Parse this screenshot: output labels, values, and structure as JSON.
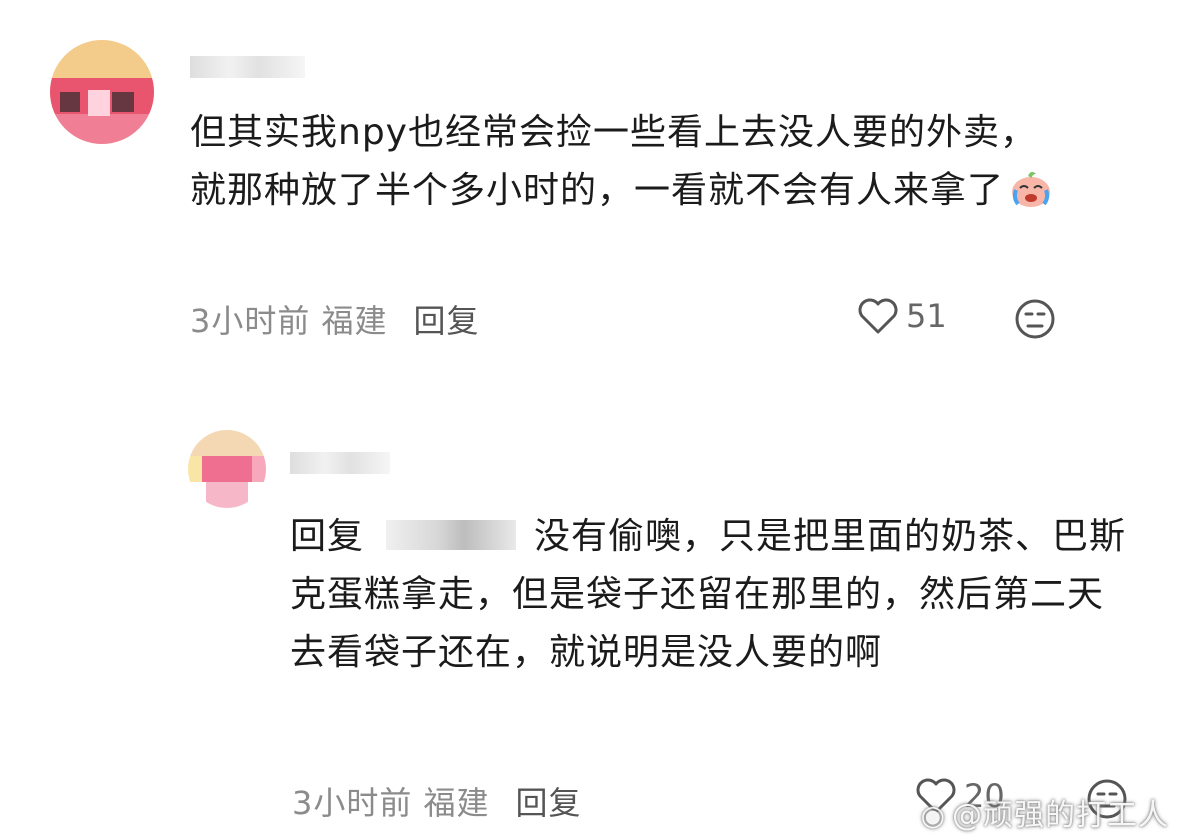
{
  "comments": [
    {
      "body": "但其实我npy也经常会捡一些看上去没人要的外卖，就那种放了半个多小时的，一看就不会有人来拿了",
      "meta": "3小时前 福建",
      "reply_label": "回复",
      "likes": "51"
    },
    {
      "reply_prefix": "回复",
      "body": "没有偷噢，只是把里面的奶茶、巴斯克蛋糕拿走，但是袋子还留在那里的，然后第二天去看袋子还在，就说明是没人要的啊",
      "meta": "3小时前 福建",
      "reply_label": "回复",
      "likes": "20"
    }
  ],
  "watermark": "@顽强的打工人",
  "icons": {
    "like": "heart-outline-icon",
    "dislike": "neutral-face-icon",
    "emoji": "crying-baby-emoji-icon",
    "weibo": "weibo-logo-icon"
  }
}
